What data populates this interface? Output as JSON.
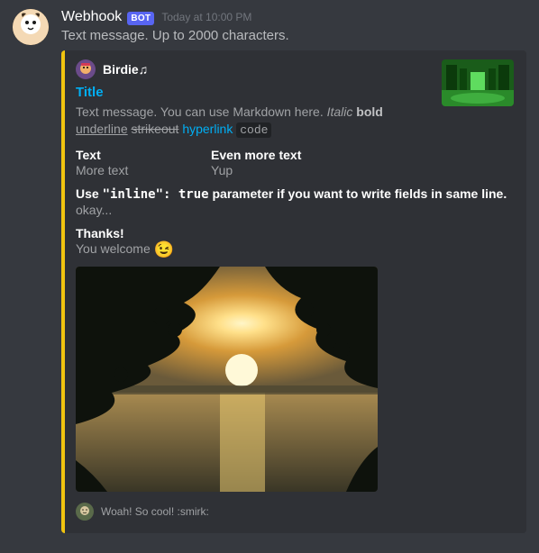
{
  "accent_color": "#f1c40f",
  "message": {
    "author": "Webhook",
    "bot_tag": "BOT",
    "timestamp": "Today at 10:00 PM",
    "text": "Text message. Up to 2000 characters."
  },
  "embed": {
    "author": {
      "name": "Birdie♫"
    },
    "title": "Title",
    "description": {
      "prefix": "Text message. You can use Markdown here. ",
      "italic": "Italic",
      "bold": "bold",
      "underline": "underline",
      "strike": "strikeout",
      "link": "hyperlink",
      "code": "code"
    },
    "fields_inline": [
      {
        "name": "Text",
        "value": "More text"
      },
      {
        "name": "Even more text",
        "value": "Yup"
      }
    ],
    "field_inline_note": {
      "name_parts": {
        "pre": "Use ",
        "code": "\"inline\": true",
        "post": " parameter if you want to write fields in same line."
      },
      "value": "okay..."
    },
    "field_thanks": {
      "name": "Thanks!",
      "value_text": "You welcome ",
      "value_emoji": "😉"
    },
    "footer": {
      "text": "Woah! So cool! :smirk:"
    }
  }
}
